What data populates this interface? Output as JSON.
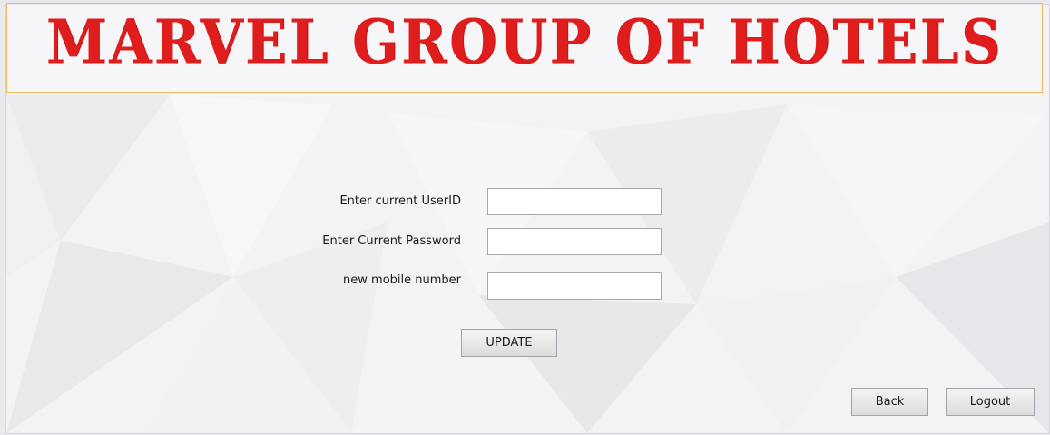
{
  "header": {
    "title": "MARVEL GROUP OF HOTELS"
  },
  "form": {
    "userid_label": "Enter current UserID",
    "userid_value": "",
    "password_label": "Enter Current Password",
    "password_value": "",
    "mobile_label": "new mobile number",
    "mobile_value": "",
    "update_label": "UPDATE"
  },
  "footer": {
    "back_label": "Back",
    "logout_label": "Logout"
  },
  "colors": {
    "title": "#e01d1d",
    "banner_border": "#f0b85e"
  }
}
